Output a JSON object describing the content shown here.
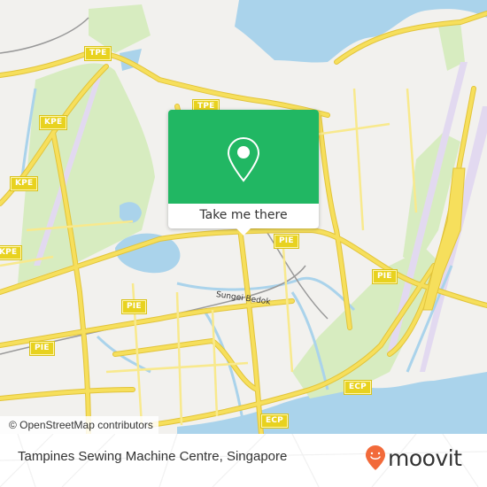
{
  "map": {
    "colors": {
      "land": "#f2f1ee",
      "water": "#aad3eb",
      "park": "#d7ecc0",
      "road_major": "#f6df5c",
      "road_casing": "#e2c43a",
      "runway": "#e2d9f0",
      "rail": "#999999"
    },
    "road_shields": [
      "TPE",
      "TPE",
      "KPE",
      "KPE",
      "KPE",
      "PIE",
      "PIE",
      "PIE",
      "PIE",
      "PIE",
      "ECP",
      "ECP"
    ],
    "place_labels": [
      "Sungei Bedok"
    ],
    "attribution": "© OpenStreetMap contributors"
  },
  "popup": {
    "icon": "map-pin-icon",
    "cta_label": "Take me there",
    "accent": "#21b763"
  },
  "footer": {
    "place_name": "Tampines Sewing Machine Centre, Singapore",
    "brand_name": "moovit",
    "brand_icon": "moovit-smile-pin-icon",
    "brand_color": "#f26a3a"
  }
}
